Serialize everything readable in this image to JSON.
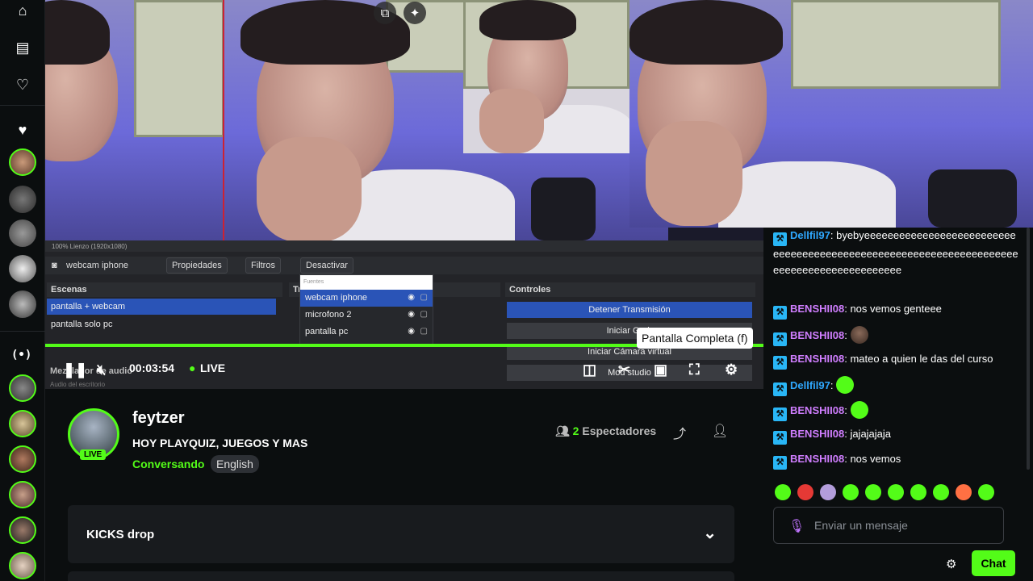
{
  "player": {
    "time": "00:03:54",
    "live_label": "LIVE",
    "tooltip": "Pantalla Completa (f)"
  },
  "obs": {
    "zoom_text": "100%   Lienzo (1920x1080)",
    "source_name": "webcam iphone",
    "properties": "Propiedades",
    "filters": "Filtros",
    "deactivate": "Desactivar",
    "scenes_title": "Escenas",
    "scenes": [
      "pantalla + webcam",
      "pantalla solo pc"
    ],
    "fuentes_header": "Fuentes",
    "sources": [
      "webcam iphone",
      "microfono 2",
      "pantalla pc"
    ],
    "controls_title": "Controles",
    "controls": [
      "Detener Transmisión",
      "Iniciar Grab",
      "Iniciar Cámara virtual",
      "Mod studio"
    ],
    "mixer_label": "Mezclador de audio",
    "mixer_sub": "Audio del escritorio",
    "trans_label": "Tr"
  },
  "channel": {
    "name": "feytzer",
    "live_badge": "LIVE",
    "title": "HOY PLAYQUIZ, JUEGOS Y MAS",
    "category": "Conversando",
    "language": "English",
    "viewers_count": "2",
    "viewers_label": "Espectadores"
  },
  "kicks": {
    "label": "KICKS drop"
  },
  "chat": {
    "messages": [
      {
        "user": "Dellfil97",
        "text": "byebyeeeeeeeeeeeeeeeeeeeeeeeeeeeeeeeeeeeeeeeeeeeeeeeeeeeeeeeeeeeeeeeeeeeeeeeeeeeeeeeeeeeeeeeeee",
        "emote": false
      },
      {
        "user": "BENSHII08",
        "text": "nos vemos genteee",
        "emote": false
      },
      {
        "user": "BENSHII08",
        "text": "",
        "emote": "face"
      },
      {
        "user": "BENSHII08",
        "text": "mateo a quien le das del curso",
        "emote": false
      },
      {
        "user": "Dellfil97",
        "text": "",
        "emote": "green"
      },
      {
        "user": "BENSHII08",
        "text": "",
        "emote": "green"
      },
      {
        "user": "BENSHII08",
        "text": "jajajajaja",
        "emote": false
      },
      {
        "user": "BENSHII08",
        "text": "nos vemos",
        "emote": false
      }
    ],
    "input_placeholder": "Enviar un mensaje",
    "send_button": "Chat"
  },
  "colors": {
    "accent": "#53fc18",
    "obs_select": "#2a54b7"
  }
}
